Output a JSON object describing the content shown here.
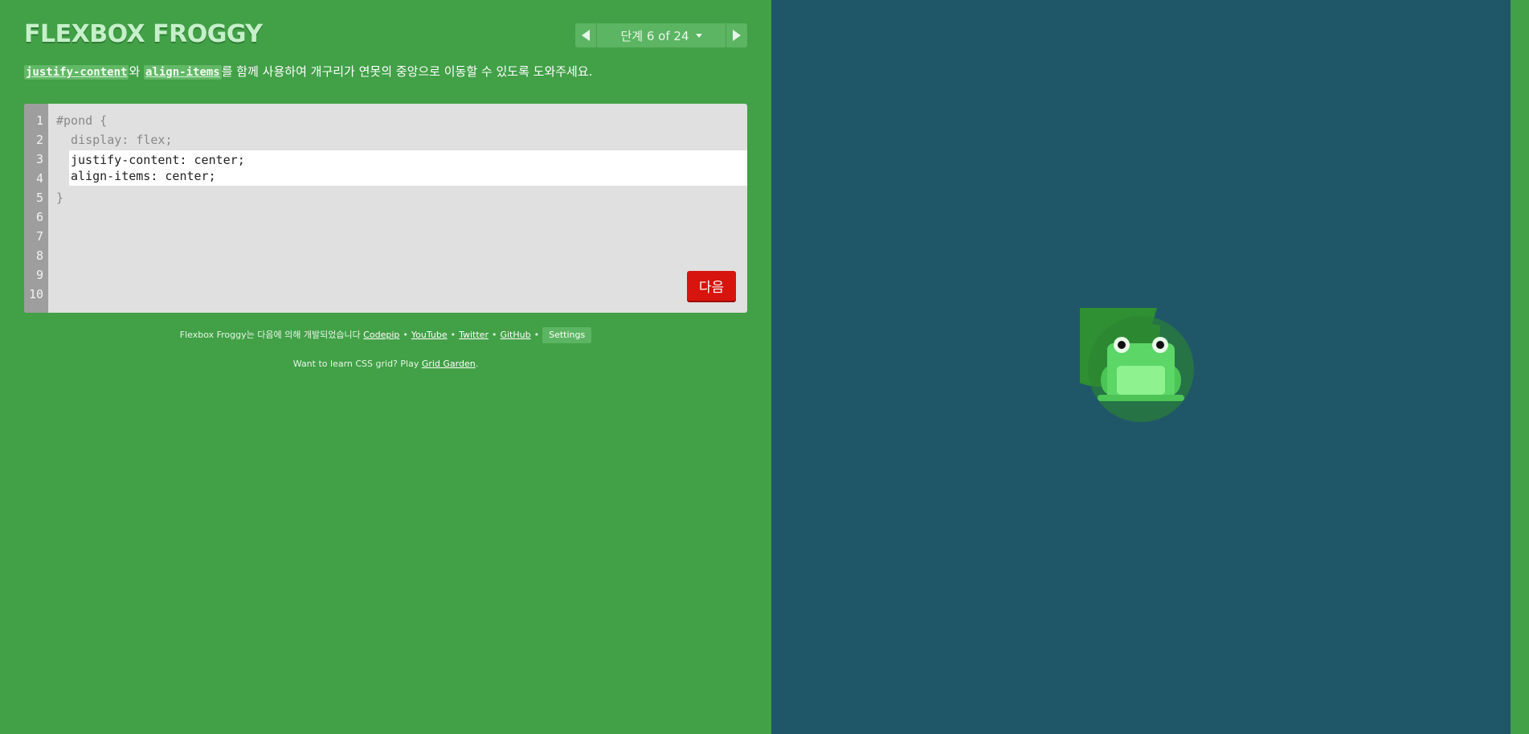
{
  "app": {
    "title": "FLEXBOX FROGGY"
  },
  "level_nav": {
    "indicator": "단계 6 of 24"
  },
  "instructions": {
    "property_1": "justify-content",
    "connector_1": "와 ",
    "property_2": "align-items",
    "text": "를 함께 사용하여 개구리가 연못의 중앙으로 이동할 수 있도록 도와주세요."
  },
  "editor": {
    "line_numbers": [
      "1",
      "2",
      "3",
      "4",
      "5",
      "6",
      "7",
      "8",
      "9",
      "10"
    ],
    "line_1": "#pond {",
    "line_2": "  display: flex;",
    "input_line_1": "justify-content: center;",
    "input_line_2": "align-items: center;",
    "line_5": "}",
    "next_button": "다음"
  },
  "credits": {
    "prefix": "Flexbox Froggy는 다음에 의해 개발되었습니다 ",
    "links": [
      "Codepip",
      "YouTube",
      "Twitter",
      "GitHub"
    ],
    "separator": "•",
    "settings": "Settings"
  },
  "promo": {
    "text": "Want to learn CSS grid? Play ",
    "link": "Grid Garden",
    "suffix": "."
  },
  "colors": {
    "sidebar_bg": "#42a047",
    "pond_bg": "#1f5768",
    "next_button_bg": "#d7140d",
    "lilypad": "#2e8f33",
    "frog": "#5cd667"
  }
}
